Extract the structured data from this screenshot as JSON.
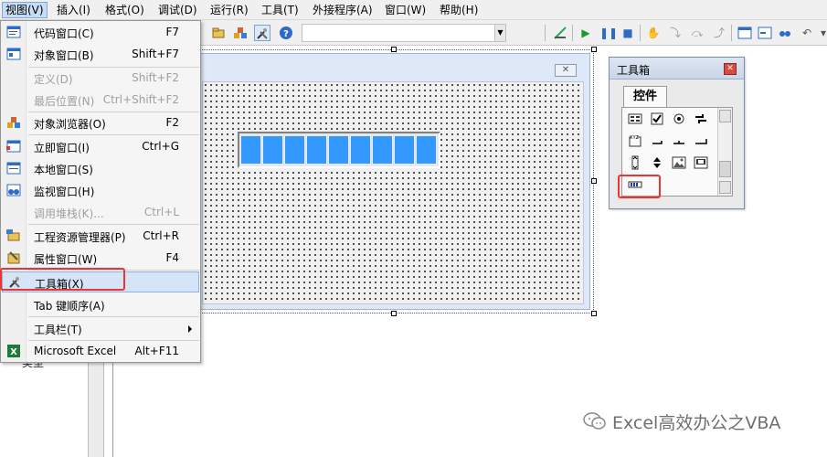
{
  "menubar": {
    "items": [
      "视图(V)",
      "插入(I)",
      "格式(O)",
      "调试(D)",
      "运行(R)",
      "工具(T)",
      "外接程序(A)",
      "窗口(W)",
      "帮助(H)"
    ]
  },
  "view_menu": {
    "items": [
      {
        "label": "代码窗口(C)",
        "shortcut": "F7",
        "icon": "code-window-icon"
      },
      {
        "label": "对象窗口(B)",
        "shortcut": "Shift+F7",
        "icon": "object-window-icon"
      },
      {
        "label": "定义(D)",
        "shortcut": "Shift+F2"
      },
      {
        "label": "最后位置(N)",
        "shortcut": "Ctrl+Shift+F2"
      },
      {
        "label": "对象浏览器(O)",
        "shortcut": "F2",
        "icon": "object-browser-icon"
      },
      {
        "label": "立即窗口(I)",
        "shortcut": "Ctrl+G",
        "icon": "immediate-window-icon"
      },
      {
        "label": "本地窗口(S)",
        "shortcut": "",
        "icon": "locals-window-icon"
      },
      {
        "label": "监视窗口(H)",
        "shortcut": "",
        "icon": "watch-window-icon"
      },
      {
        "label": "调用堆栈(K)...",
        "shortcut": "Ctrl+L"
      },
      {
        "label": "工程资源管理器(P)",
        "shortcut": "Ctrl+R",
        "icon": "project-explorer-icon"
      },
      {
        "label": "属性窗口(W)",
        "shortcut": "F4",
        "icon": "properties-window-icon"
      },
      {
        "label": "工具箱(X)",
        "shortcut": "",
        "icon": "toolbox-icon"
      },
      {
        "label": "Tab 键顺序(A)",
        "shortcut": ""
      },
      {
        "label": "工具栏(T)",
        "shortcut": ""
      },
      {
        "label": "Microsoft Excel",
        "shortcut": "Alt+F11",
        "icon": "excel-icon"
      }
    ]
  },
  "left_pane": {
    "label": "类型"
  },
  "userform": {
    "close_glyph": "✕",
    "progress": 1.0,
    "progress_blocks": 9
  },
  "toolbox": {
    "title": "工具箱",
    "close_glyph": "✕",
    "tab": "控件"
  },
  "watermark": {
    "text": "Excel高效办公之VBA"
  },
  "colors": {
    "accent_blue": "#3399ff",
    "highlight_red": "#ee3333"
  }
}
